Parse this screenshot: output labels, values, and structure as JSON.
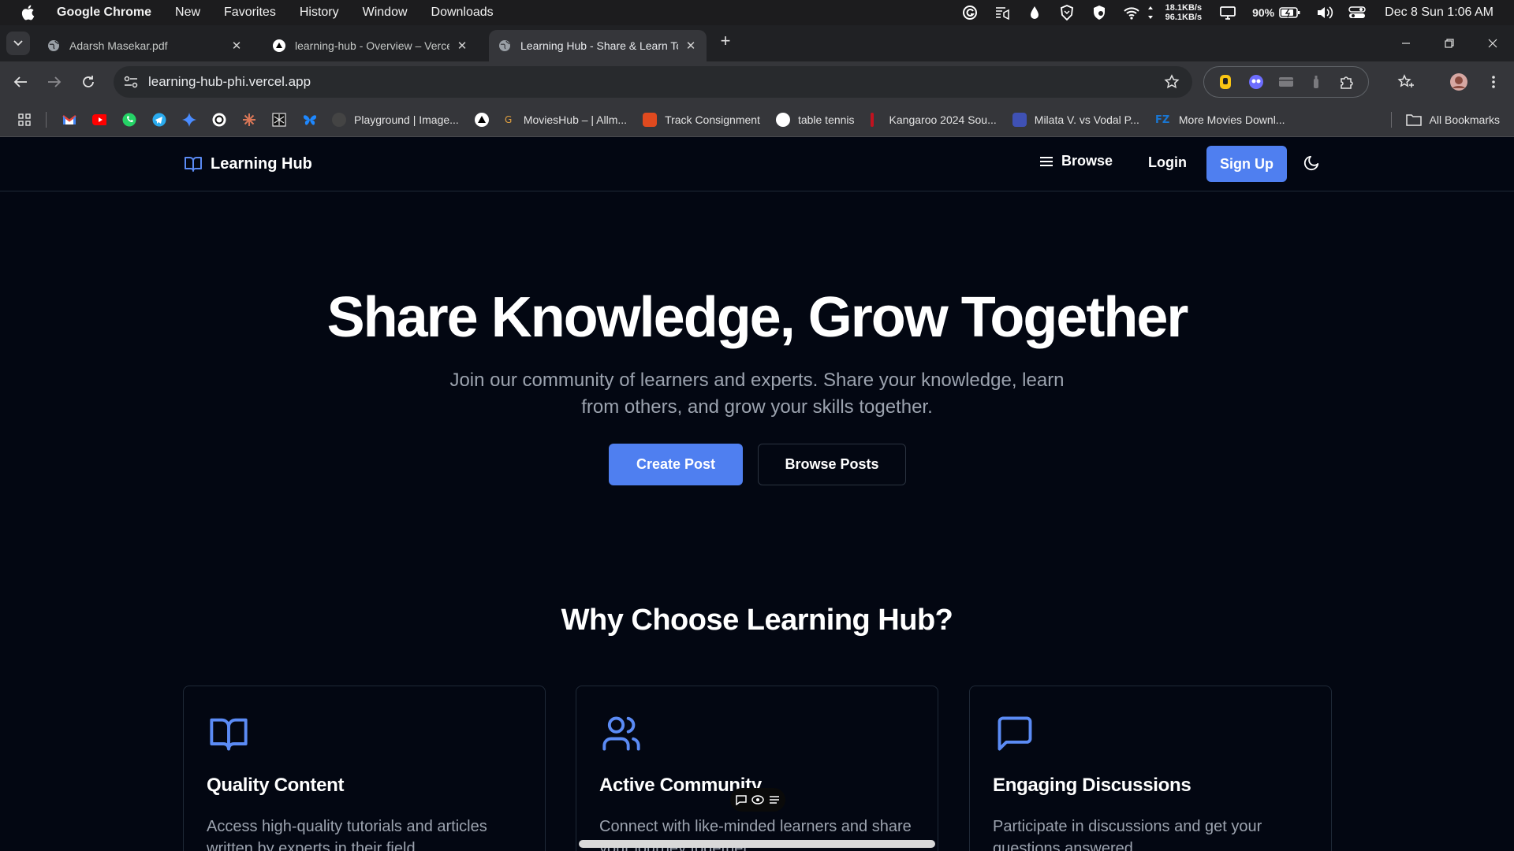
{
  "menubar": {
    "app_name": "Google Chrome",
    "items": [
      "New",
      "Favorites",
      "History",
      "Window",
      "Downloads"
    ],
    "net_up": "18.1KB/s",
    "net_down": "96.1KB/s",
    "battery": "90%",
    "clock": "Dec 8 Sun 1:06 AM"
  },
  "tabs": [
    {
      "title": "Adarsh Masekar.pdf",
      "icon": "globe-icon"
    },
    {
      "title": "learning-hub - Overview – Vercel",
      "icon": "vercel-triangle-icon"
    },
    {
      "title": "Learning Hub - Share & Learn Together",
      "icon": "globe-icon",
      "active": true
    }
  ],
  "toolbar": {
    "url": "learning-hub-phi.vercel.app"
  },
  "bookmarks": {
    "items": [
      {
        "label": "Playground | Image...",
        "color": "#444"
      },
      {
        "label": "",
        "color": "#000"
      },
      {
        "label": "MoviesHub – | Allm...",
        "color": "#3a3a3a"
      },
      {
        "label": "Track Consignment",
        "color": "#e04a1f"
      },
      {
        "label": "table tennis",
        "color": "#ffffff"
      },
      {
        "label": "Kangaroo 2024 Sou...",
        "color": "#c1121f"
      },
      {
        "label": "Milata V. vs Vodal P...",
        "color": "#3f51b5"
      },
      {
        "label": "More Movies Downl...",
        "color": "#1976d2"
      }
    ],
    "all_label": "All Bookmarks"
  },
  "site": {
    "brand": "Learning Hub",
    "nav": {
      "browse": "Browse",
      "login": "Login",
      "signup": "Sign Up"
    },
    "hero": {
      "title": "Share Knowledge, Grow Together",
      "subtitle": "Join our community of learners and experts. Share your knowledge, learn from others, and grow your skills together.",
      "cta_primary": "Create Post",
      "cta_secondary": "Browse Posts"
    },
    "features_title": "Why Choose Learning Hub?",
    "features": [
      {
        "title": "Quality Content",
        "desc": "Access high-quality tutorials and articles written by experts in their field.",
        "icon": "book-open-icon"
      },
      {
        "title": "Active Community",
        "desc": "Connect with like-minded learners and share your journey together.",
        "icon": "users-icon"
      },
      {
        "title": "Engaging Discussions",
        "desc": "Participate in discussions and get your questions answered.",
        "icon": "message-square-icon"
      }
    ]
  },
  "colors": {
    "accent": "#4f7ff0",
    "background": "#030712",
    "muted_text": "#9ca3af",
    "border": "#1f2937"
  }
}
